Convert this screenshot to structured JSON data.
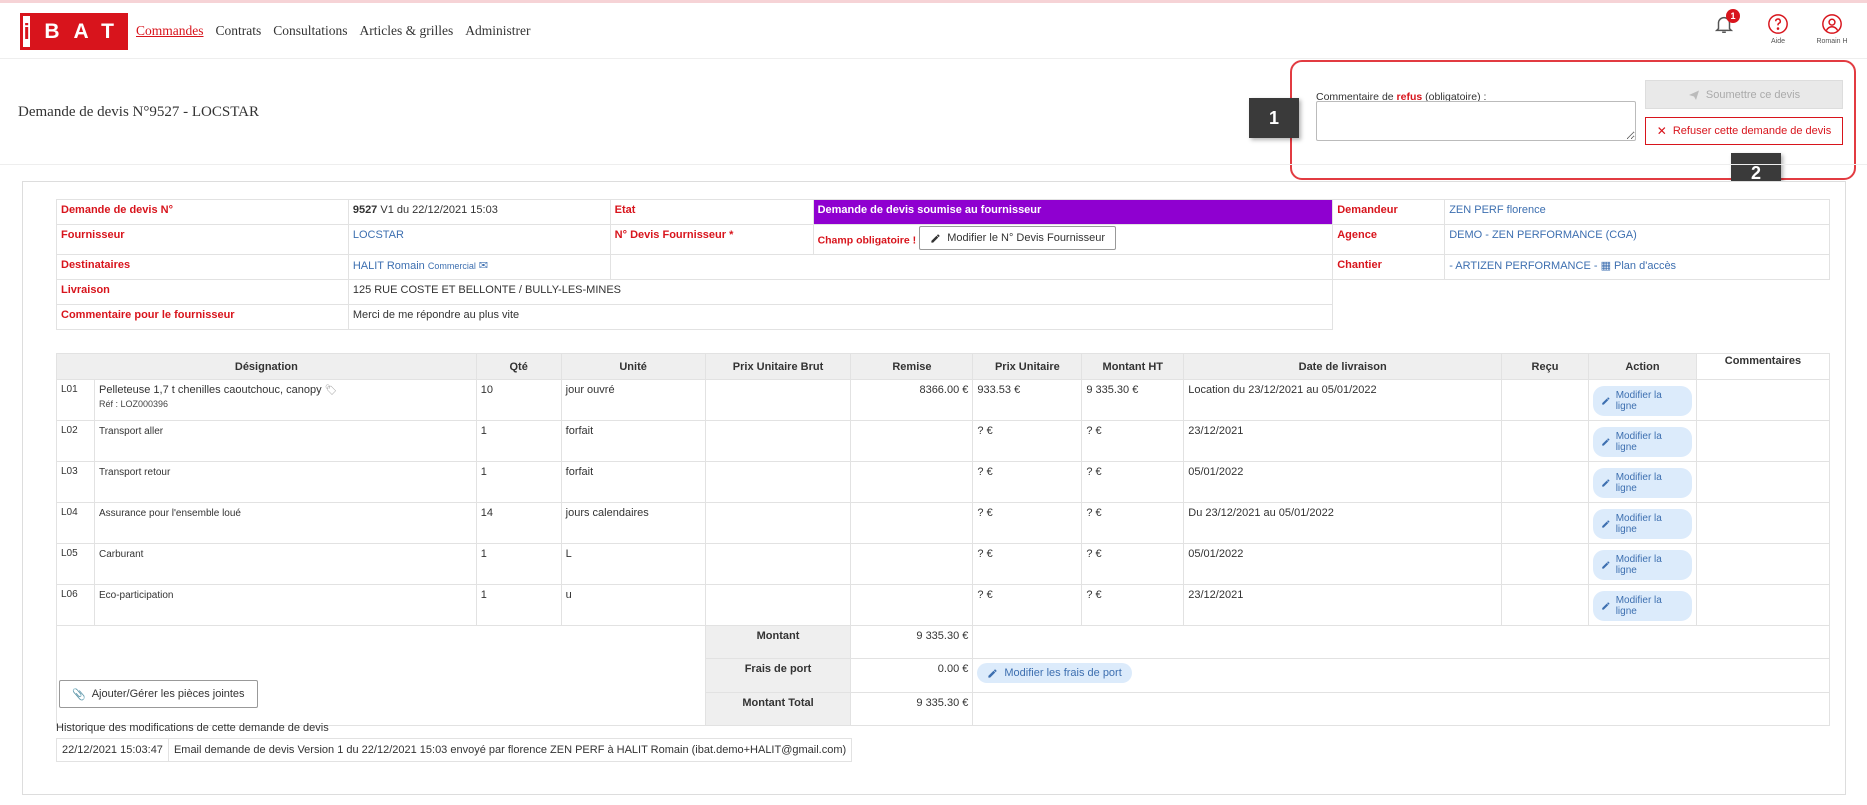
{
  "header": {
    "logo_letter": "i",
    "logo_text": "BAT",
    "nav": [
      "Commandes",
      "Contrats",
      "Consultations",
      "Articles & grilles",
      "Administrer"
    ],
    "notifications_count": "1",
    "help_label": "Aide",
    "user_label": "Romain H"
  },
  "page": {
    "title": "Demande de devis N°9527 - LOCSTAR"
  },
  "refusal": {
    "label_pre": "Commentaire de ",
    "label_bold": "refus",
    "label_post": " (obligatoire) :",
    "submit_label": "Soumettre ce devis",
    "refuse_label": "Refuser cette demande de devis"
  },
  "callouts": [
    "1",
    "2"
  ],
  "info": {
    "demande_label": "Demande de devis N°",
    "demande_num": "9527",
    "demande_suffix": " V1 du 22/12/2021 15:03",
    "etat_label": "Etat",
    "etat_value": "Demande de devis soumise au fournisseur",
    "demandeur_label": "Demandeur",
    "demandeur_value": "ZEN PERF florence",
    "fournisseur_label": "Fournisseur",
    "fournisseur_value": "LOCSTAR",
    "ndevis_label": "N° Devis Fournisseur *",
    "champ_oblig": "Champ obligatoire !",
    "modifier_ndevis": "Modifier le N° Devis Fournisseur",
    "agence_label": "Agence",
    "agence_value": "DEMO - ZEN PERFORMANCE (CGA)",
    "destinataires_label": "Destinataires",
    "destinataire_name": "HALIT Romain",
    "destinataire_role": "Commercial",
    "chantier_label": "Chantier",
    "chantier_value": "- ARTIZEN PERFORMANCE -",
    "plan_acces": "Plan d'accès",
    "livraison_label": "Livraison",
    "livraison_value": "125 RUE COSTE ET BELLONTE / BULLY-LES-MINES",
    "commentaire_label": "Commentaire pour le fournisseur",
    "commentaire_value": "Merci de me répondre au plus vite"
  },
  "lines": {
    "headers": [
      "Désignation",
      "Qté",
      "Unité",
      "Prix Unitaire Brut",
      "Remise",
      "Prix Unitaire",
      "Montant HT",
      "Date de livraison",
      "Reçu",
      "Action",
      "Commentaires"
    ],
    "action_label": "Modifier la ligne",
    "rows": [
      {
        "id": "L01",
        "designation": "Pelleteuse 1,7 t chenilles caoutchouc, canopy",
        "ref": "Réf : LOZ000396",
        "qte": "10",
        "unite": "jour ouvré",
        "remise": "8366.00 €",
        "pu": "933.53 €",
        "ht": "9 335.30 €",
        "date": "Location du 23/12/2021 au 05/01/2022"
      },
      {
        "id": "L02",
        "designation": "Transport aller",
        "ref": "",
        "qte": "1",
        "unite": "forfait",
        "remise": "",
        "pu": "? €",
        "ht": "? €",
        "date": "23/12/2021"
      },
      {
        "id": "L03",
        "designation": "Transport retour",
        "ref": "",
        "qte": "1",
        "unite": "forfait",
        "remise": "",
        "pu": "? €",
        "ht": "? €",
        "date": "05/01/2022"
      },
      {
        "id": "L04",
        "designation": "Assurance pour l'ensemble loué",
        "ref": "",
        "qte": "14",
        "unite": "jours calendaires",
        "remise": "",
        "pu": "? €",
        "ht": "? €",
        "date": "Du 23/12/2021 au 05/01/2022"
      },
      {
        "id": "L05",
        "designation": "Carburant",
        "ref": "",
        "qte": "1",
        "unite": "L",
        "remise": "",
        "pu": "? €",
        "ht": "? €",
        "date": "05/01/2022"
      },
      {
        "id": "L06",
        "designation": "Eco-participation",
        "ref": "",
        "qte": "1",
        "unite": "u",
        "remise": "",
        "pu": "? €",
        "ht": "? €",
        "date": "23/12/2021"
      }
    ],
    "totals": {
      "montant_label": "Montant",
      "montant_value": "9 335.30 €",
      "frais_label": "Frais de port",
      "frais_value": "0.00 €",
      "frais_button": "Modifier les frais de port",
      "total_label": "Montant Total",
      "total_value": "9 335.30 €"
    }
  },
  "attachments": {
    "button_label": "Ajouter/Gérer les pièces jointes"
  },
  "history": {
    "title": "Historique des modifications de cette demande de devis",
    "entries": [
      {
        "date": "22/12/2021 15:03:47",
        "text": "Email demande de devis Version 1 du 22/12/2021 15:03 envoyé par florence ZEN PERF à HALIT Romain (ibat.demo+HALIT@gmail.com)"
      }
    ]
  },
  "colors": {
    "brand_red": "#d8141c",
    "status_purple": "#8f00d0",
    "link_blue": "#3d6fb0"
  }
}
